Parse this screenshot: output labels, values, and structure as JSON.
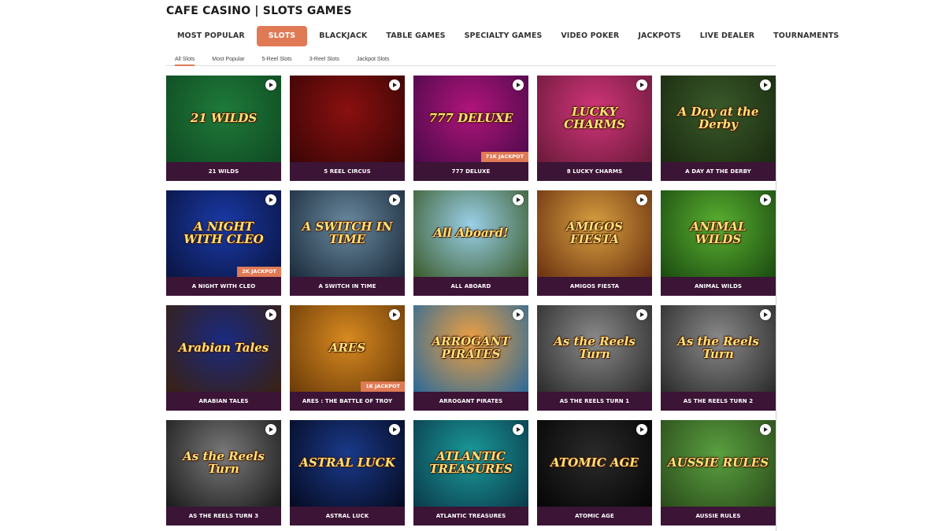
{
  "page": {
    "title": "CAFE CASINO | SLOTS GAMES"
  },
  "main_tabs": [
    {
      "label": "MOST POPULAR",
      "active": false
    },
    {
      "label": "SLOTS",
      "active": true
    },
    {
      "label": "BLACKJACK",
      "active": false
    },
    {
      "label": "TABLE GAMES",
      "active": false
    },
    {
      "label": "SPECIALTY GAMES",
      "active": false
    },
    {
      "label": "VIDEO POKER",
      "active": false
    },
    {
      "label": "JACKPOTS",
      "active": false
    },
    {
      "label": "LIVE DEALER",
      "active": false
    },
    {
      "label": "TOURNAMENTS",
      "active": false
    }
  ],
  "sub_tabs": [
    {
      "label": "All Slots",
      "active": true
    },
    {
      "label": "Most Popular",
      "active": false
    },
    {
      "label": "5-Reel Slots",
      "active": false
    },
    {
      "label": "3-Reel Slots",
      "active": false
    },
    {
      "label": "Jackpot Slots",
      "active": false
    }
  ],
  "colors": {
    "accent": "#e07a55",
    "label_bg": "#3b1436"
  },
  "games": [
    {
      "title": "21 WILDS",
      "art_text": "21 WILDS",
      "jackpot": "",
      "bg": [
        "#1f7a3a",
        "#0f4a22"
      ]
    },
    {
      "title": "5 REEL CIRCUS",
      "art_text": "",
      "jackpot": "",
      "bg": [
        "#8a1010",
        "#3a0505"
      ]
    },
    {
      "title": "777 DELUXE",
      "art_text": "777 DELUXE",
      "jackpot": "71K JACKPOT",
      "bg": [
        "#b0147a",
        "#4a0a4a"
      ]
    },
    {
      "title": "8 LUCKY CHARMS",
      "art_text": "LUCKY CHARMS",
      "jackpot": "",
      "bg": [
        "#d2357a",
        "#6a1a3a"
      ]
    },
    {
      "title": "A DAY AT THE DERBY",
      "art_text": "A Day at the Derby",
      "jackpot": "",
      "bg": [
        "#3a5a2a",
        "#1a2a10"
      ]
    },
    {
      "title": "A NIGHT WITH CLEO",
      "art_text": "A NIGHT WITH CLEO",
      "jackpot": "2K JACKPOT",
      "bg": [
        "#1a3aa8",
        "#0a1440"
      ]
    },
    {
      "title": "A SWITCH IN TIME",
      "art_text": "A SWITCH IN TIME",
      "jackpot": "",
      "bg": [
        "#6a8aa0",
        "#1a2a3a"
      ]
    },
    {
      "title": "ALL ABOARD",
      "art_text": "All Aboard!",
      "jackpot": "",
      "bg": [
        "#9ad0e8",
        "#3a5a2a"
      ]
    },
    {
      "title": "AMIGOS FIESTA",
      "art_text": "AMIGOS FIESTA",
      "jackpot": "",
      "bg": [
        "#d8a040",
        "#6a3010"
      ]
    },
    {
      "title": "ANIMAL WILDS",
      "art_text": "ANIMAL WILDS",
      "jackpot": "",
      "bg": [
        "#5ab030",
        "#1a4a10"
      ]
    },
    {
      "title": "ARABIAN TALES",
      "art_text": "Arabian Tales",
      "jackpot": "",
      "bg": [
        "#1a2a80",
        "#3a2010"
      ]
    },
    {
      "title": "ARES : THE BATTLE OF TROY",
      "art_text": "ARES",
      "jackpot": "1K JACKPOT",
      "bg": [
        "#d88a20",
        "#6a3a08"
      ]
    },
    {
      "title": "ARROGANT PIRATES",
      "art_text": "ARROGANT PIRATES",
      "jackpot": "",
      "bg": [
        "#f0a040",
        "#2a6a9a"
      ]
    },
    {
      "title": "AS THE REELS TURN 1",
      "art_text": "As the Reels Turn",
      "jackpot": "",
      "bg": [
        "#8a8a8a",
        "#2a2a2a"
      ]
    },
    {
      "title": "AS THE REELS TURN 2",
      "art_text": "As the Reels Turn",
      "jackpot": "",
      "bg": [
        "#8a8a8a",
        "#2a2a2a"
      ]
    },
    {
      "title": "AS THE REELS TURN 3",
      "art_text": "As the Reels Turn",
      "jackpot": "",
      "bg": [
        "#7a7a7a",
        "#1a1a1a"
      ]
    },
    {
      "title": "ASTRAL LUCK",
      "art_text": "ASTRAL LUCK",
      "jackpot": "",
      "bg": [
        "#1a3a8a",
        "#050a20"
      ]
    },
    {
      "title": "ATLANTIC TREASURES",
      "art_text": "ATLANTIC TREASURES",
      "jackpot": "",
      "bg": [
        "#1a9a9a",
        "#0a3a4a"
      ]
    },
    {
      "title": "ATOMIC AGE",
      "art_text": "ATOMIC AGE",
      "jackpot": "",
      "bg": [
        "#2a2a2a",
        "#050505"
      ]
    },
    {
      "title": "AUSSIE RULES",
      "art_text": "AUSSIE RULES",
      "jackpot": "",
      "bg": [
        "#5aa040",
        "#2a4a1a"
      ]
    }
  ]
}
